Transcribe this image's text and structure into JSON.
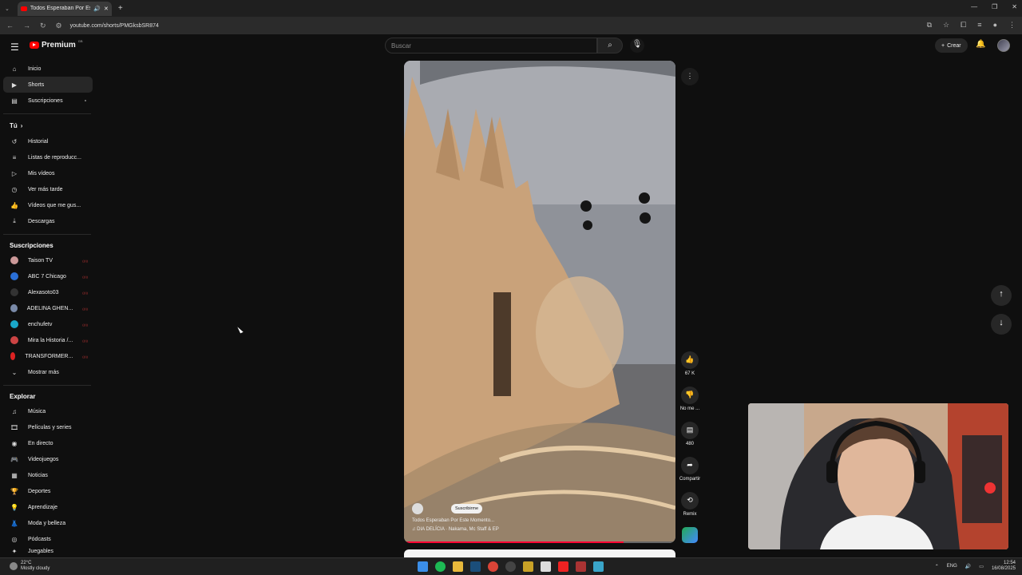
{
  "browser": {
    "tab_title": "Todos Esperaban Por Este M",
    "url": "youtube.com/shorts/PMGksbSR874",
    "window_controls": [
      "—",
      "❐",
      "✕"
    ]
  },
  "header": {
    "logo": "Premium",
    "logo_region": "GB",
    "search_placeholder": "Buscar",
    "create_label": "Crear"
  },
  "sidebar": {
    "main": [
      {
        "label": "Inicio",
        "icon": "home-icon"
      },
      {
        "label": "Shorts",
        "icon": "shorts-icon"
      },
      {
        "label": "Suscripciones",
        "icon": "subscriptions-icon"
      }
    ],
    "you_title": "Tú",
    "you": [
      {
        "label": "Historial",
        "icon": "history-icon"
      },
      {
        "label": "Listas de reproducc...",
        "icon": "playlists-icon"
      },
      {
        "label": "Mis vídeos",
        "icon": "my-videos-icon"
      },
      {
        "label": "Ver más tarde",
        "icon": "watch-later-icon"
      },
      {
        "label": "Vídeos que me gus...",
        "icon": "liked-icon"
      },
      {
        "label": "Descargas",
        "icon": "downloads-icon"
      }
    ],
    "subs_title": "Suscripciones",
    "subs": [
      {
        "label": "Taison TV",
        "color": "#c99"
      },
      {
        "label": "ABC 7 Chicago",
        "color": "#2a6fd6"
      },
      {
        "label": "Alexasoto03",
        "color": "#333"
      },
      {
        "label": "ADELINA GHEN...",
        "color": "#7a8aa8"
      },
      {
        "label": "enchufetv",
        "color": "#1aa7c9"
      },
      {
        "label": "Mira la Historia /...",
        "color": "#c44"
      },
      {
        "label": "TRANSFORMER...",
        "color": "#d22"
      }
    ],
    "show_more": "Mostrar más",
    "explore_title": "Explorar",
    "explore": [
      {
        "label": "Música",
        "icon": "music-icon"
      },
      {
        "label": "Películas y series",
        "icon": "movies-icon"
      },
      {
        "label": "En directo",
        "icon": "live-icon"
      },
      {
        "label": "Videojuegos",
        "icon": "gaming-icon"
      },
      {
        "label": "Noticias",
        "icon": "news-icon"
      },
      {
        "label": "Deportes",
        "icon": "sports-icon"
      },
      {
        "label": "Aprendizaje",
        "icon": "learning-icon"
      },
      {
        "label": "Moda y belleza",
        "icon": "fashion-icon"
      },
      {
        "label": "Pódcasts",
        "icon": "podcasts-icon"
      },
      {
        "label": "Juegables",
        "icon": "playables-icon"
      }
    ]
  },
  "short": {
    "subscribe_label": "Suscribirme",
    "title": "Todos Esperaban Por Este Momento...",
    "sound": "♫ DIA DELÍCIA · Nakama, Mc Staff & EP",
    "progress": 0.81
  },
  "actions": {
    "likes": "67 K",
    "dislike": "No me ...",
    "comments": "480",
    "share": "Compartir",
    "remix": "Remix"
  },
  "taskbar": {
    "temp": "22°C",
    "weather": "Mostly cloudy",
    "lang": "ENG",
    "time": "12:54",
    "date": "16/08/2025"
  }
}
